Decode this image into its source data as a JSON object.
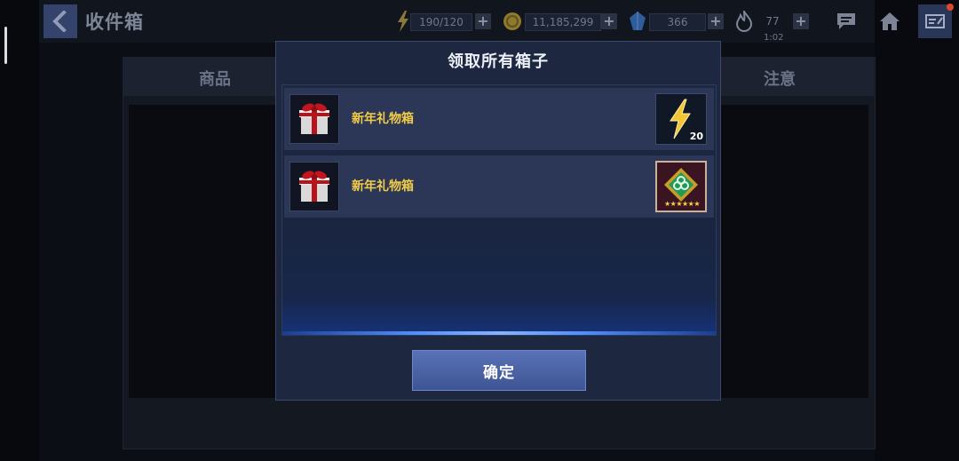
{
  "header": {
    "title": "收件箱"
  },
  "resources": {
    "energy": "190/120",
    "gold": "11,185,299",
    "crystal": "366",
    "stamina": "77",
    "stamina_timer": "1:02"
  },
  "background_tabs": {
    "left": "商品",
    "right": "注意"
  },
  "dialog": {
    "title": "领取所有箱子",
    "items": [
      {
        "label": "新年礼物箱",
        "reward_icon": "energy-bolt-icon",
        "reward_count": "20"
      },
      {
        "label": "新年礼物箱",
        "reward_icon": "gem-badge-icon",
        "reward_stars": "★★★★★★"
      }
    ],
    "confirm_label": "确定"
  },
  "colors": {
    "accent_blue": "#3f5593",
    "item_label_gold": "#f1cd46",
    "glow": "#4f8dff"
  }
}
